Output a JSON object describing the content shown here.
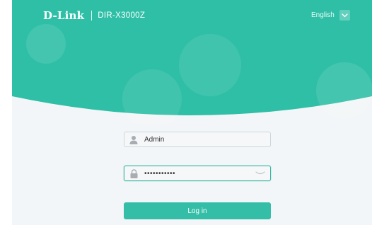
{
  "header": {
    "brand_logo": "D-Link",
    "model": "DIR-X3000Z",
    "language": {
      "selected": "English",
      "chevron_icon": "chevron-down-icon"
    }
  },
  "login": {
    "username": {
      "icon": "user-icon",
      "value": "Admin"
    },
    "password": {
      "icon": "lock-icon",
      "value": "•••••••••••",
      "toggle_icon": "eye-closed-icon"
    },
    "submit_label": "Log in"
  },
  "colors": {
    "accent": "#34bea7",
    "header_teal": "#2fbfa7",
    "page_background": "#f3f6f8",
    "field_background": "#f5f7f8"
  }
}
